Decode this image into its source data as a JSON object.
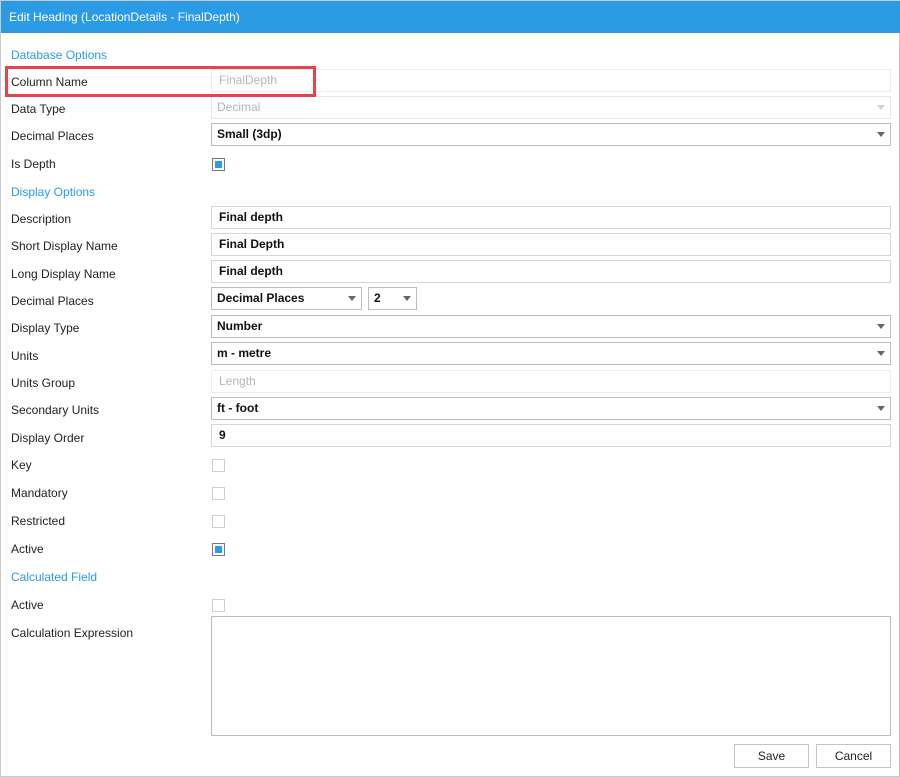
{
  "window": {
    "title": "Edit Heading (LocationDetails - FinalDepth)"
  },
  "database_options": {
    "heading": "Database Options",
    "column_name": {
      "label": "Column Name",
      "value": "FinalDepth"
    },
    "data_type": {
      "label": "Data Type",
      "value": "Decimal"
    },
    "decimal_places": {
      "label": "Decimal Places",
      "value": "Small (3dp)"
    },
    "is_depth": {
      "label": "Is Depth",
      "checked": true
    }
  },
  "display_options": {
    "heading": "Display Options",
    "description": {
      "label": "Description",
      "value": "Final depth"
    },
    "short_display_name": {
      "label": "Short Display Name",
      "value": "Final Depth"
    },
    "long_display_name": {
      "label": "Long Display Name",
      "value": "Final depth"
    },
    "decimal_places": {
      "label": "Decimal Places",
      "mode": "Decimal Places",
      "count": "2"
    },
    "display_type": {
      "label": "Display Type",
      "value": "Number"
    },
    "units": {
      "label": "Units",
      "value": "m - metre"
    },
    "units_group": {
      "label": "Units Group",
      "value": "Length"
    },
    "secondary_units": {
      "label": "Secondary Units",
      "value": "ft - foot"
    },
    "display_order": {
      "label": "Display Order",
      "value": "9"
    },
    "key": {
      "label": "Key",
      "checked": false
    },
    "mandatory": {
      "label": "Mandatory",
      "checked": false
    },
    "restricted": {
      "label": "Restricted",
      "checked": false
    },
    "active": {
      "label": "Active",
      "checked": true
    }
  },
  "calculated_field": {
    "heading": "Calculated Field",
    "active": {
      "label": "Active",
      "checked": false
    },
    "expression": {
      "label": "Calculation Expression",
      "value": ""
    }
  },
  "buttons": {
    "save": "Save",
    "cancel": "Cancel"
  },
  "colors": {
    "accent": "#2b9be6",
    "highlight": "#e8434a"
  }
}
